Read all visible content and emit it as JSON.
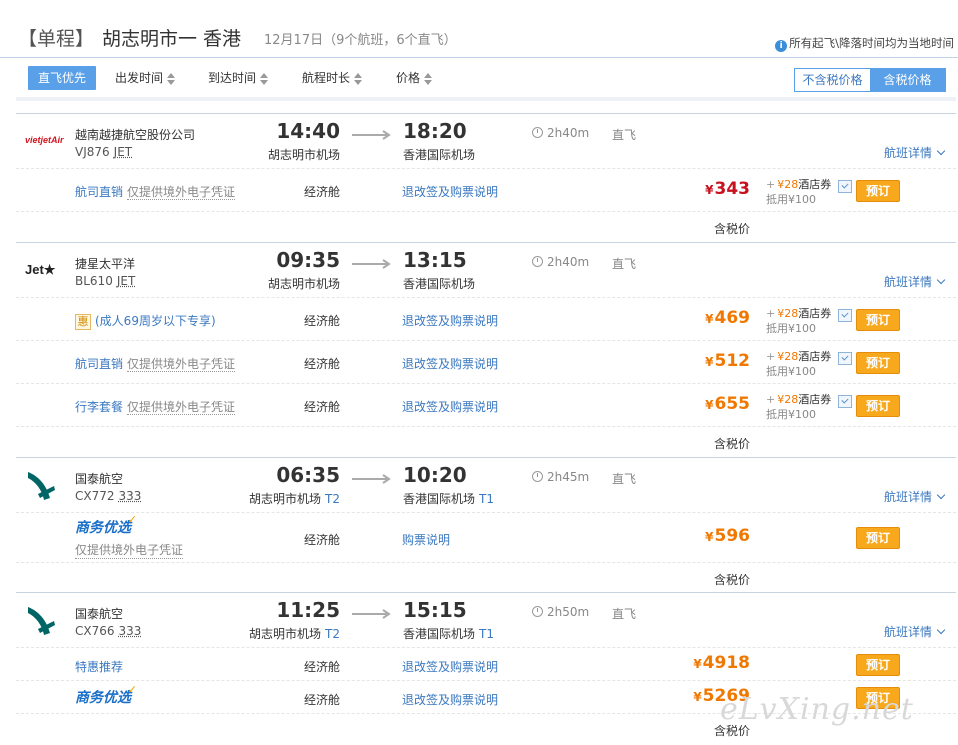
{
  "header": {
    "trip_type": "【单程】",
    "route": "胡志明市一 香港",
    "date_info": "12月17日（9个航班，6个直飞）",
    "tz_note": "所有起飞\\降落时间均为当地时间"
  },
  "sortbar": {
    "direct_first": "直飞优先",
    "depart_time": "出发时间",
    "arrive_time": "到达时间",
    "duration": "航程时长",
    "price": "价格",
    "excl_tax": "不含税价格",
    "incl_tax": "含税价格"
  },
  "flights": [
    {
      "airline": "越南越捷航空股份公司",
      "logo": "vietjet-logo",
      "logo_text": "vietjetAir",
      "flight_no": "VJ876",
      "plane": "JET",
      "dep_time": "14:40",
      "dep_airport": "胡志明市机场",
      "dep_terminal": "",
      "arr_time": "18:20",
      "arr_airport": "香港国际机场",
      "arr_terminal": "",
      "duration": "2h40m",
      "direct": "直飞",
      "details": "航班详情",
      "fares": [
        {
          "name": "航司直销",
          "sub": "仅提供境外电子凭证",
          "cabin": "经济舱",
          "rules": "退改签及购票说明",
          "currency": "¥",
          "price": "343",
          "coupon_amt": "28",
          "coupon_label": "酒店券",
          "coupon_deduct": "抵用¥100",
          "book": "预订"
        }
      ],
      "tax_note": "含税价"
    },
    {
      "airline": "捷星太平洋",
      "logo": "jetstar-logo",
      "logo_text": "Jet★",
      "flight_no": "BL610",
      "plane": "JET",
      "dep_time": "09:35",
      "dep_airport": "胡志明市机场",
      "dep_terminal": "",
      "arr_time": "13:15",
      "arr_airport": "香港国际机场",
      "arr_terminal": "",
      "duration": "2h40m",
      "direct": "直飞",
      "details": "航班详情",
      "fares": [
        {
          "name": "(成人69周岁以下专享)",
          "badge": "惠",
          "sub": "",
          "cabin": "经济舱",
          "rules": "退改签及购票说明",
          "currency": "¥",
          "price": "469",
          "coupon_amt": "28",
          "coupon_label": "酒店券",
          "coupon_deduct": "抵用¥100",
          "book": "预订"
        },
        {
          "name": "航司直销",
          "sub": "仅提供境外电子凭证",
          "cabin": "经济舱",
          "rules": "退改签及购票说明",
          "currency": "¥",
          "price": "512",
          "coupon_amt": "28",
          "coupon_label": "酒店券",
          "coupon_deduct": "抵用¥100",
          "book": "预订"
        },
        {
          "name": "行李套餐",
          "sub": "仅提供境外电子凭证",
          "cabin": "经济舱",
          "rules": "退改签及购票说明",
          "currency": "¥",
          "price": "655",
          "coupon_amt": "28",
          "coupon_label": "酒店券",
          "coupon_deduct": "抵用¥100",
          "book": "预订"
        }
      ],
      "tax_note": "含税价"
    },
    {
      "airline": "国泰航空",
      "logo": "cathay-logo",
      "flight_no": "CX772",
      "plane": "333",
      "dep_time": "06:35",
      "dep_airport": "胡志明市机场",
      "dep_terminal": "T2",
      "arr_time": "10:20",
      "arr_airport": "香港国际机场",
      "arr_terminal": "T1",
      "duration": "2h45m",
      "direct": "直飞",
      "details": "航班详情",
      "fares": [
        {
          "name": "商务优选",
          "biz": true,
          "sub": "仅提供境外电子凭证",
          "cabin": "经济舱",
          "rules": "购票说明",
          "currency": "¥",
          "price": "596",
          "book": "预订"
        }
      ],
      "tax_note": "含税价"
    },
    {
      "airline": "国泰航空",
      "logo": "cathay-logo",
      "flight_no": "CX766",
      "plane": "333",
      "dep_time": "11:25",
      "dep_airport": "胡志明市机场",
      "dep_terminal": "T2",
      "arr_time": "15:15",
      "arr_airport": "香港国际机场",
      "arr_terminal": "T1",
      "duration": "2h50m",
      "direct": "直飞",
      "details": "航班详情",
      "fares": [
        {
          "name": "特惠推荐",
          "sub": "",
          "cabin": "经济舱",
          "rules": "退改签及购票说明",
          "currency": "¥",
          "price": "4918",
          "book": "预订"
        },
        {
          "name": "商务优选",
          "biz": true,
          "sub": "",
          "cabin": "经济舱",
          "rules": "退改签及购票说明",
          "currency": "¥",
          "price": "5269",
          "book": "预订"
        }
      ],
      "tax_note": "含税价"
    }
  ],
  "watermark": "eLvXing.net"
}
